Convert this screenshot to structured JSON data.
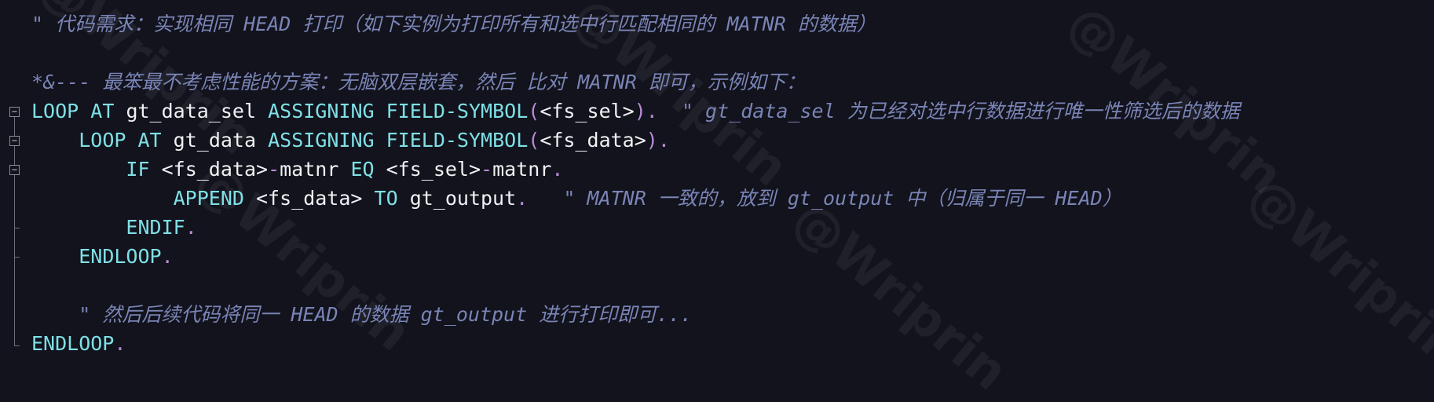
{
  "code": {
    "line1_comment": "\" 代码需求：实现相同 HEAD 打印（如下实例为打印所有和选中行匹配相同的 MATNR 的数据）",
    "line3_comment": "*&--- 最笨最不考虑性能的方案：无脑双层嵌套，然后 比对 MATNR 即可，示例如下：",
    "l4": {
      "kw1": "LOOP",
      "kw2": "AT",
      "id1": "gt_data_sel",
      "kw3": "ASSIGNING",
      "kw4": "FIELD-SYMBOL",
      "p1": "(",
      "fs": "<fs_sel>",
      "p2": ").",
      "comment": "\" gt_data_sel 为已经对选中行数据进行唯一性筛选后的数据"
    },
    "l5": {
      "kw1": "LOOP",
      "kw2": "AT",
      "id1": "gt_data",
      "kw3": "ASSIGNING",
      "kw4": "FIELD-SYMBOL",
      "p1": "(",
      "fs": "<fs_data>",
      "p2": ")."
    },
    "l6": {
      "kw1": "IF",
      "a": "<fs_data>",
      "d1": "-",
      "b": "matnr",
      "kw2": "EQ",
      "c": "<fs_sel>",
      "d2": "-",
      "e": "matnr",
      "p": "."
    },
    "l7": {
      "kw1": "APPEND",
      "a": "<fs_data>",
      "kw2": "TO",
      "b": "gt_output",
      "p": ".",
      "comment": "\" MATNR 一致的，放到 gt_output 中（归属于同一 HEAD）"
    },
    "l8": {
      "kw": "ENDIF",
      "p": "."
    },
    "l9": {
      "kw": "ENDLOOP",
      "p": "."
    },
    "l11_comment": "\" 然后后续代码将同一 HEAD 的数据 gt_output 进行打印即可...",
    "l12": {
      "kw": "ENDLOOP",
      "p": "."
    }
  },
  "gutter": {
    "fold_glyph": "−"
  },
  "watermark": "@Wriprin"
}
